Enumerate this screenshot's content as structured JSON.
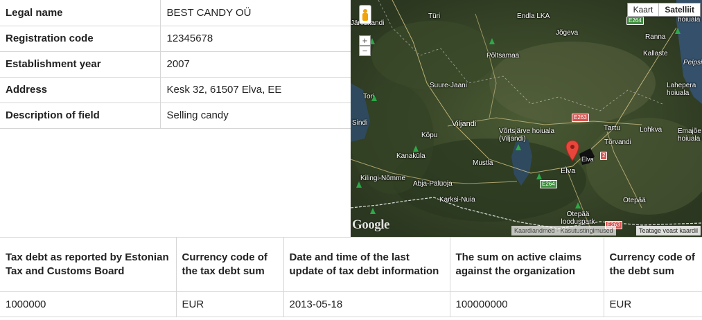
{
  "company": {
    "rows": [
      {
        "label": "Legal name",
        "value": "BEST CANDY OÜ"
      },
      {
        "label": "Registration code",
        "value": "12345678"
      },
      {
        "label": "Establishment year",
        "value": "2007"
      },
      {
        "label": "Address",
        "value": "Kesk 32, 61507 Elva, EE"
      },
      {
        "label": "Description of field",
        "value": "Selling candy"
      }
    ]
  },
  "map": {
    "map_type_buttons": [
      "Kaart",
      "Satelliit"
    ],
    "active_map_type": "Satelliit",
    "zoom_in": "+",
    "zoom_out": "−",
    "logo": "Google",
    "attribution": [
      "Kaardiandmed",
      "-",
      "Kasutustingimused"
    ],
    "report_link": "Teatage veast kaardil",
    "marker_icon": "map-pin-icon",
    "pegman_icon": "street-view-pegman-icon",
    "places": [
      "Järvakandi",
      "Türi",
      "Endla LKA",
      "Jõgeva",
      "Ranna",
      "Kallaste",
      "Peipsi",
      "Lahepera hoiuala",
      "Põltsamaa",
      "Suure-Jaani",
      "Tori",
      "Sindi",
      "Kõpu",
      "Viljandi",
      "Võrtsjärve hoiuala (Viljandi)",
      "Tartu",
      "Lohkva",
      "Tõrvandi",
      "Emajõe hoiuala",
      "Kanaküla",
      "Mustla",
      "Elva",
      "Kilingi-Nõmme",
      "Abja-Paluoja",
      "Karksi-Nuia",
      "Otepää looduspark",
      "Otepää",
      "Elva",
      "hoiuala"
    ],
    "roads": [
      "E264",
      "E263",
      "E264",
      "2",
      "E263"
    ]
  },
  "tax": {
    "headers": [
      "Tax debt as reported by Estonian Tax and Customs Board",
      "Currency code of the tax debt sum",
      "Date and time of the last update of tax debt information",
      "The sum on active claims against the organization",
      "Currency code of the debt sum"
    ],
    "row": [
      "1000000",
      "EUR",
      "2013-05-18",
      "100000000",
      "EUR"
    ]
  }
}
